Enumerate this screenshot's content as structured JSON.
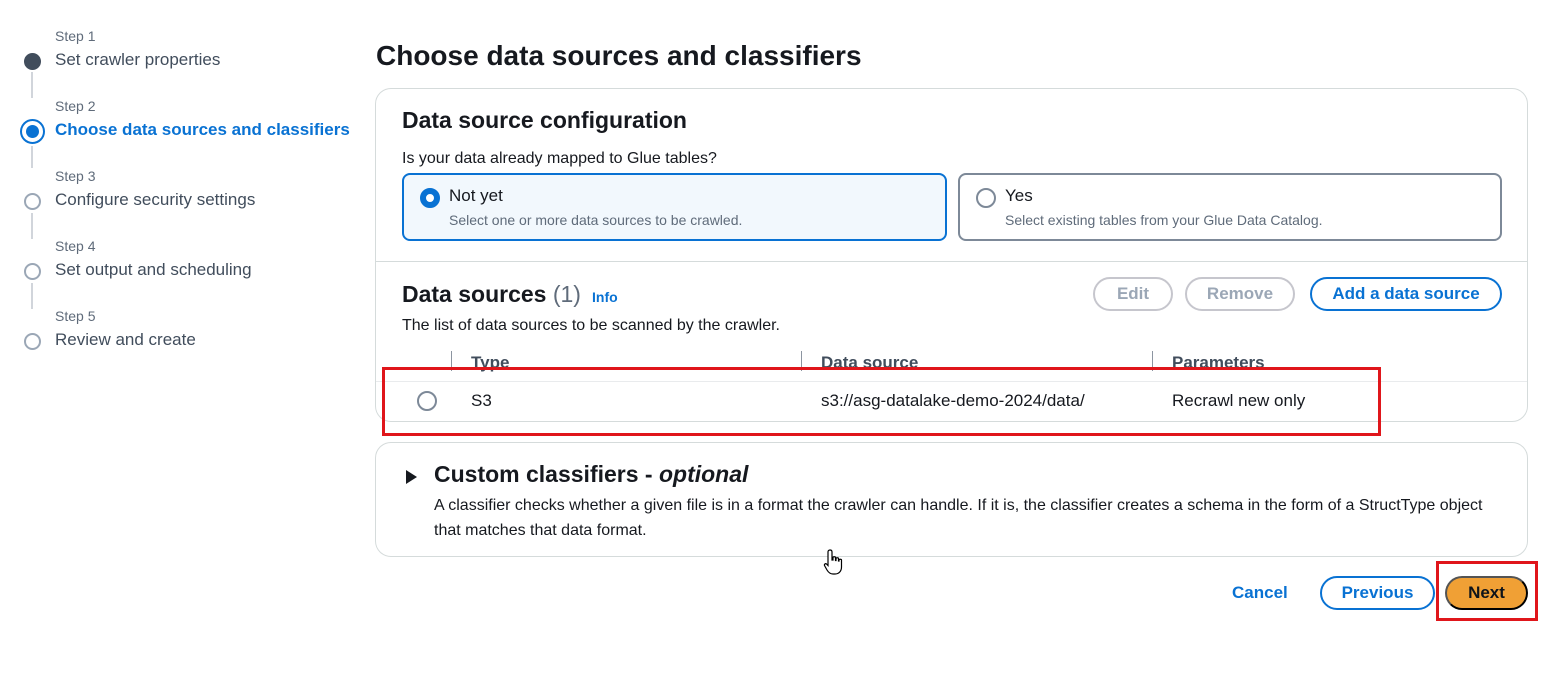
{
  "stepper": {
    "steps": [
      {
        "num": "Step 1",
        "label": "Set crawler properties",
        "state": "done"
      },
      {
        "num": "Step 2",
        "label": "Choose data sources and classifiers",
        "state": "active"
      },
      {
        "num": "Step 3",
        "label": "Configure security settings",
        "state": "pending"
      },
      {
        "num": "Step 4",
        "label": "Set output and scheduling",
        "state": "pending"
      },
      {
        "num": "Step 5",
        "label": "Review and create",
        "state": "pending"
      }
    ]
  },
  "page": {
    "title": "Choose data sources and classifiers"
  },
  "config": {
    "title": "Data source configuration",
    "question": "Is your data already mapped to Glue tables?",
    "options": [
      {
        "label": "Not yet",
        "description": "Select one or more data sources to be crawled.",
        "selected": true
      },
      {
        "label": "Yes",
        "description": "Select existing tables from your Glue Data Catalog.",
        "selected": false
      }
    ]
  },
  "data_sources": {
    "title": "Data sources",
    "count": "(1)",
    "info": "Info",
    "description": "The list of data sources to be scanned by the crawler.",
    "buttons": {
      "edit": "Edit",
      "remove": "Remove",
      "add": "Add a data source"
    },
    "columns": [
      "Type",
      "Data source",
      "Parameters"
    ],
    "rows": [
      {
        "type": "S3",
        "source": "s3://asg-datalake-demo-2024/data/",
        "parameters": "Recrawl new only"
      }
    ]
  },
  "classifiers": {
    "title": "Custom classifiers - ",
    "title_optional": "optional",
    "description": "A classifier checks whether a given file is in a format the crawler can handle. If it is, the classifier creates a schema in the form of a StructType object that matches that data format."
  },
  "footer": {
    "cancel": "Cancel",
    "previous": "Previous",
    "next": "Next"
  },
  "colors": {
    "accent": "#0972d3",
    "next_button": "#f0a035",
    "highlight": "#e0161b"
  }
}
